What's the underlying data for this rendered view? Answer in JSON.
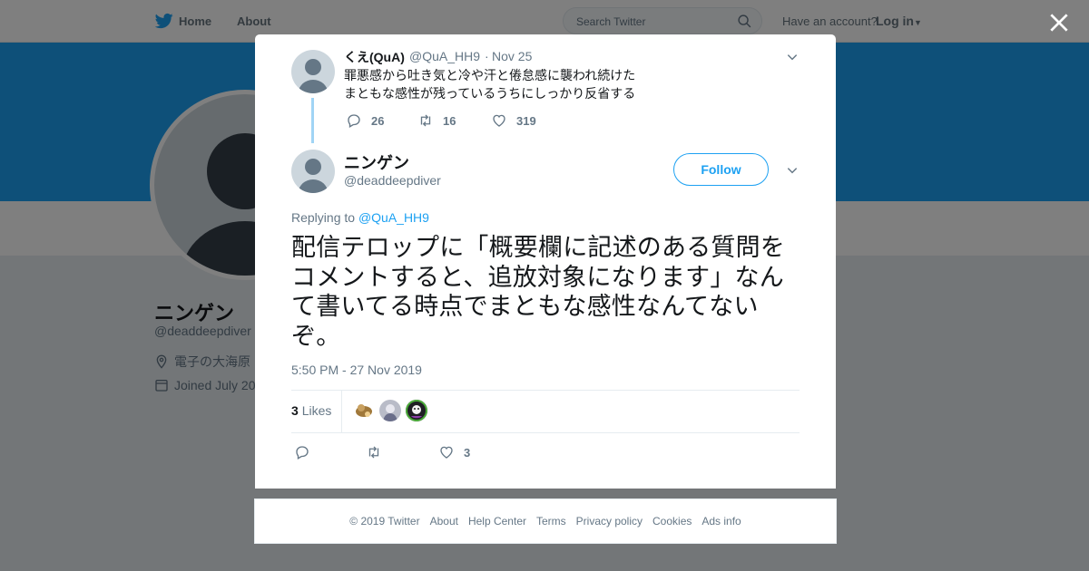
{
  "topbar": {
    "home_label": "Home",
    "about_label": "About",
    "search_placeholder": "Search Twitter",
    "have_account": "Have an account?",
    "login_label": "Log in"
  },
  "profile": {
    "name": "ニンゲン",
    "handle": "@deaddeepdiver",
    "location": "電子の大海原",
    "joined": "Joined July 20"
  },
  "parent_tweet": {
    "name": "くえ(QuA)",
    "handle": "@QuA_HH9",
    "separator": "·",
    "date": "Nov 25",
    "text": "罪悪感から吐き気と冷や汗と倦怠感に襲われ続けた\nまともな感性が残っているうちにしっかり反省する",
    "replies": "26",
    "retweets": "16",
    "likes": "319"
  },
  "main_tweet": {
    "name": "ニンゲン",
    "handle": "@deaddeepdiver",
    "follow_label": "Follow",
    "replying_prefix": "Replying to",
    "replying_handle": "@QuA_HH9",
    "text": "配信テロップに「概要欄に記述のある質問をコメントすると、追放対象になります」なんて書いてる時点でまともな感性なんてないぞ。",
    "timestamp": "5:50 PM - 27 Nov 2019",
    "likes_count": "3",
    "likes_label": "Likes",
    "action_likes": "3"
  },
  "footer": {
    "copyright": "© 2019 Twitter",
    "links": [
      "About",
      "Help Center",
      "Terms",
      "Privacy policy",
      "Cookies",
      "Ads info"
    ]
  },
  "colors": {
    "accent": "#1da1f2",
    "thread_line": "#a0d4f5",
    "text_secondary": "#657786"
  }
}
